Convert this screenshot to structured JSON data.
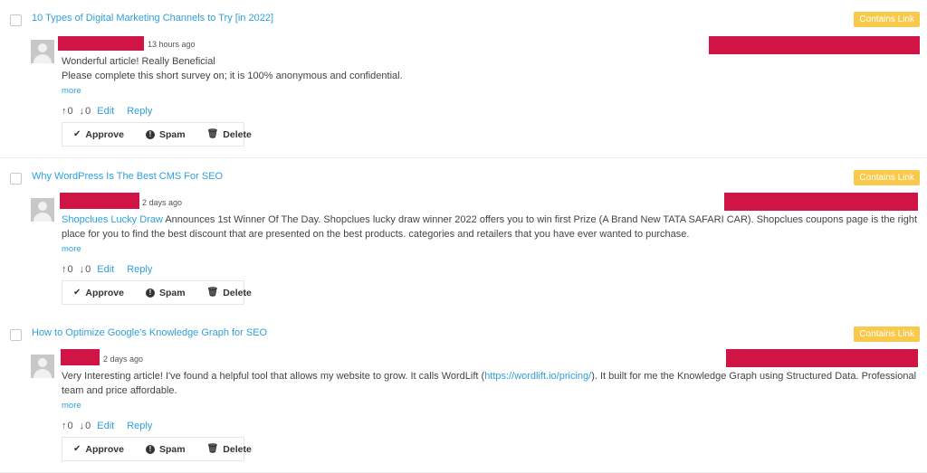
{
  "comments": [
    {
      "post_title": "10 Types of Digital Marketing Channels to Try [in 2022]",
      "badge": "Contains Link",
      "time": "13 hours ago",
      "line1": "Wonderful article! Really Beneficial",
      "line2": "Please complete this short survey on; it is 100% anonymous and confidential.",
      "more": "more",
      "upvotes": "0",
      "downvotes": "0",
      "edit": "Edit",
      "reply": "Reply",
      "approve": "Approve",
      "spam": "Spam",
      "delete": "Delete"
    },
    {
      "post_title": "Why WordPress Is The Best CMS For SEO",
      "badge": "Contains Link",
      "time": "2 days ago",
      "link_text": "Shopclues Lucky Draw",
      "text_after": " Announces 1st Winner Of The Day. Shopclues lucky draw winner 2022 offers you to win first Prize (A Brand New TATA SAFARI CAR). Shopclues coupons page is the right place for you to find the best discount that are presented on the best products. categories and retailers that you have ever wanted to purchase.",
      "more": "more",
      "upvotes": "0",
      "downvotes": "0",
      "edit": "Edit",
      "reply": "Reply",
      "approve": "Approve",
      "spam": "Spam",
      "delete": "Delete"
    },
    {
      "post_title": "How to Optimize Google's Knowledge Graph for SEO",
      "badge": "Contains Link",
      "time": "2 days ago",
      "text_before": "Very Interesting article! I've found a helpful tool that allows my website to grow. It calls WordLift (",
      "link_text": "https://wordlift.io/pricing/",
      "text_after": "). It built for me the Knowledge Graph using Structured Data. Professional team and price affordable.",
      "more": "more",
      "upvotes": "0",
      "downvotes": "0",
      "edit": "Edit",
      "reply": "Reply",
      "approve": "Approve",
      "spam": "Spam",
      "delete": "Delete"
    }
  ],
  "colors": {
    "link": "#2f9fdc",
    "badge": "#f8c94a",
    "redaction": "#d01446"
  },
  "icons": {
    "upvote": "arrow-up-icon",
    "downvote": "arrow-down-icon",
    "approve": "check-icon",
    "spam": "exclamation-circle-icon",
    "delete": "trash-icon",
    "avatar": "default-avatar-icon"
  }
}
